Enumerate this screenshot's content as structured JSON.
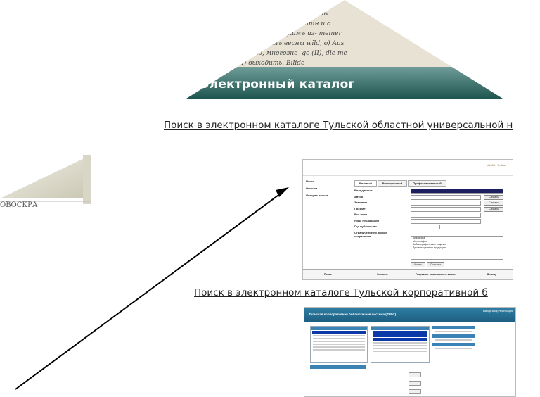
{
  "banner": {
    "title": "Электронный каталог",
    "texture_lines": [
      "го мы",
      "ермапін и о",
      "омецкимъ из- meiner",
      "Вызвалъ весны wild, о) Aus",
      "сновнаго, многознв- ge (II), die me",
      "корня (II) выходить. Bilide"
    ],
    "colors": {
      "teal_top": "#6f9c98",
      "teal_bottom": "#1f5650",
      "paper": "#e8e2d4"
    }
  },
  "links": {
    "regional": "Поиск в электронном каталоге Тульской областной универсальной н",
    "corporate": "Поиск в электронном каталоге Тульской корпоративной б"
  },
  "fragment": {
    "text": "ОВОСКРА"
  },
  "screenshot1": {
    "brand": "Irbis64 · Online",
    "sidebar": [
      "Поиск",
      "Очистка",
      "История поиска"
    ],
    "tabs": [
      "Базовый",
      "Расширенный",
      "Профессиональный"
    ],
    "fields": [
      {
        "label": "База данных",
        "button": ""
      },
      {
        "label": "Автор",
        "button": "Словарь"
      },
      {
        "label": "Заглавие",
        "button": "Словарь"
      },
      {
        "label": "Предмет",
        "button": "Словарь"
      },
      {
        "label": "Все поля",
        "button": ""
      },
      {
        "label": "Язык публикации",
        "button": ""
      },
      {
        "label": "Год публикации",
        "button": ""
      },
      {
        "label": "Ограничение по форме сохранения",
        "button": ""
      }
    ],
    "list_items": [
      "Аналитика",
      "Монография",
      "Библиографическое издание",
      "Диссертационная продукция"
    ],
    "buttons": [
      "Искать",
      "Очистить"
    ],
    "footer": [
      "Поиск",
      "Уточнить",
      "Отправить выполненные заказы",
      "Выход"
    ]
  },
  "screenshot2": {
    "title": "Тульская корпоративная библиотечная система (ТКБС)",
    "header_links": "Помощь   Вход   Регистрация"
  }
}
